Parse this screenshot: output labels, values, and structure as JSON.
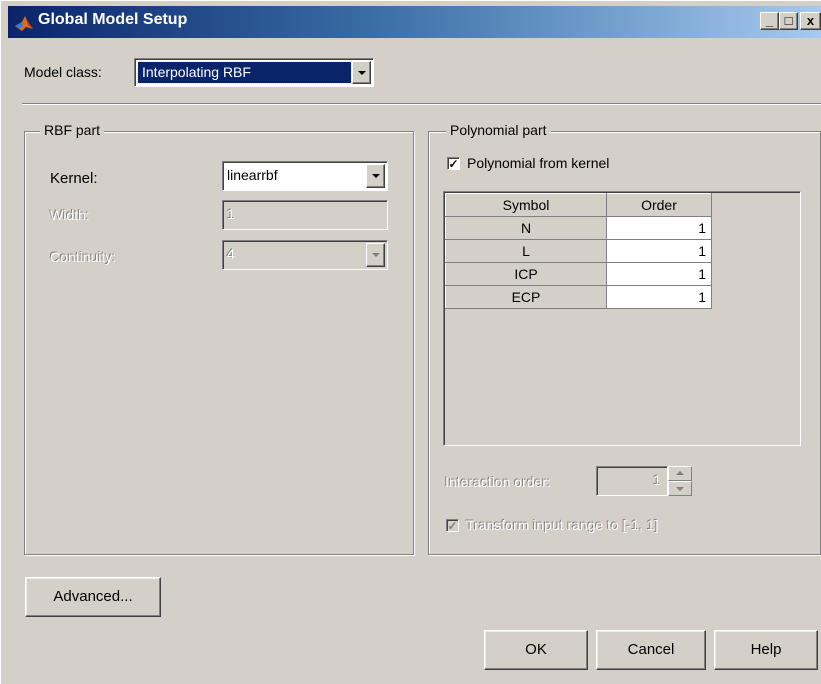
{
  "window": {
    "title": "Global Model Setup",
    "controls": {
      "minimize": "_",
      "maximize": "□",
      "close": "x"
    }
  },
  "model_class": {
    "label": "Model class:",
    "value": "Interpolating RBF"
  },
  "rbf_part": {
    "legend": "RBF part",
    "kernel": {
      "label": "Kernel:",
      "value": "linearrbf"
    },
    "width": {
      "label": "Width:",
      "value": "1"
    },
    "continuity": {
      "label": "Continuity:",
      "value": "4"
    }
  },
  "polynomial_part": {
    "legend": "Polynomial part",
    "from_kernel": {
      "label": "Polynomial from kernel",
      "checked": true
    },
    "table": {
      "headers": [
        "Symbol",
        "Order"
      ],
      "rows": [
        {
          "symbol": "N",
          "order": "1"
        },
        {
          "symbol": "L",
          "order": "1"
        },
        {
          "symbol": "ICP",
          "order": "1"
        },
        {
          "symbol": "ECP",
          "order": "1"
        }
      ]
    },
    "interaction_order": {
      "label": "Interaction order:",
      "value": "1"
    },
    "transform": {
      "label": "Transform input range to [-1, 1]",
      "checked": true
    }
  },
  "buttons": {
    "advanced": "Advanced...",
    "ok": "OK",
    "cancel": "Cancel",
    "help": "Help"
  },
  "colors": {
    "titlebar_start": "#0a246a",
    "titlebar_end": "#a6caf0",
    "face": "#d4d0c8",
    "selection": "#0a246a"
  }
}
